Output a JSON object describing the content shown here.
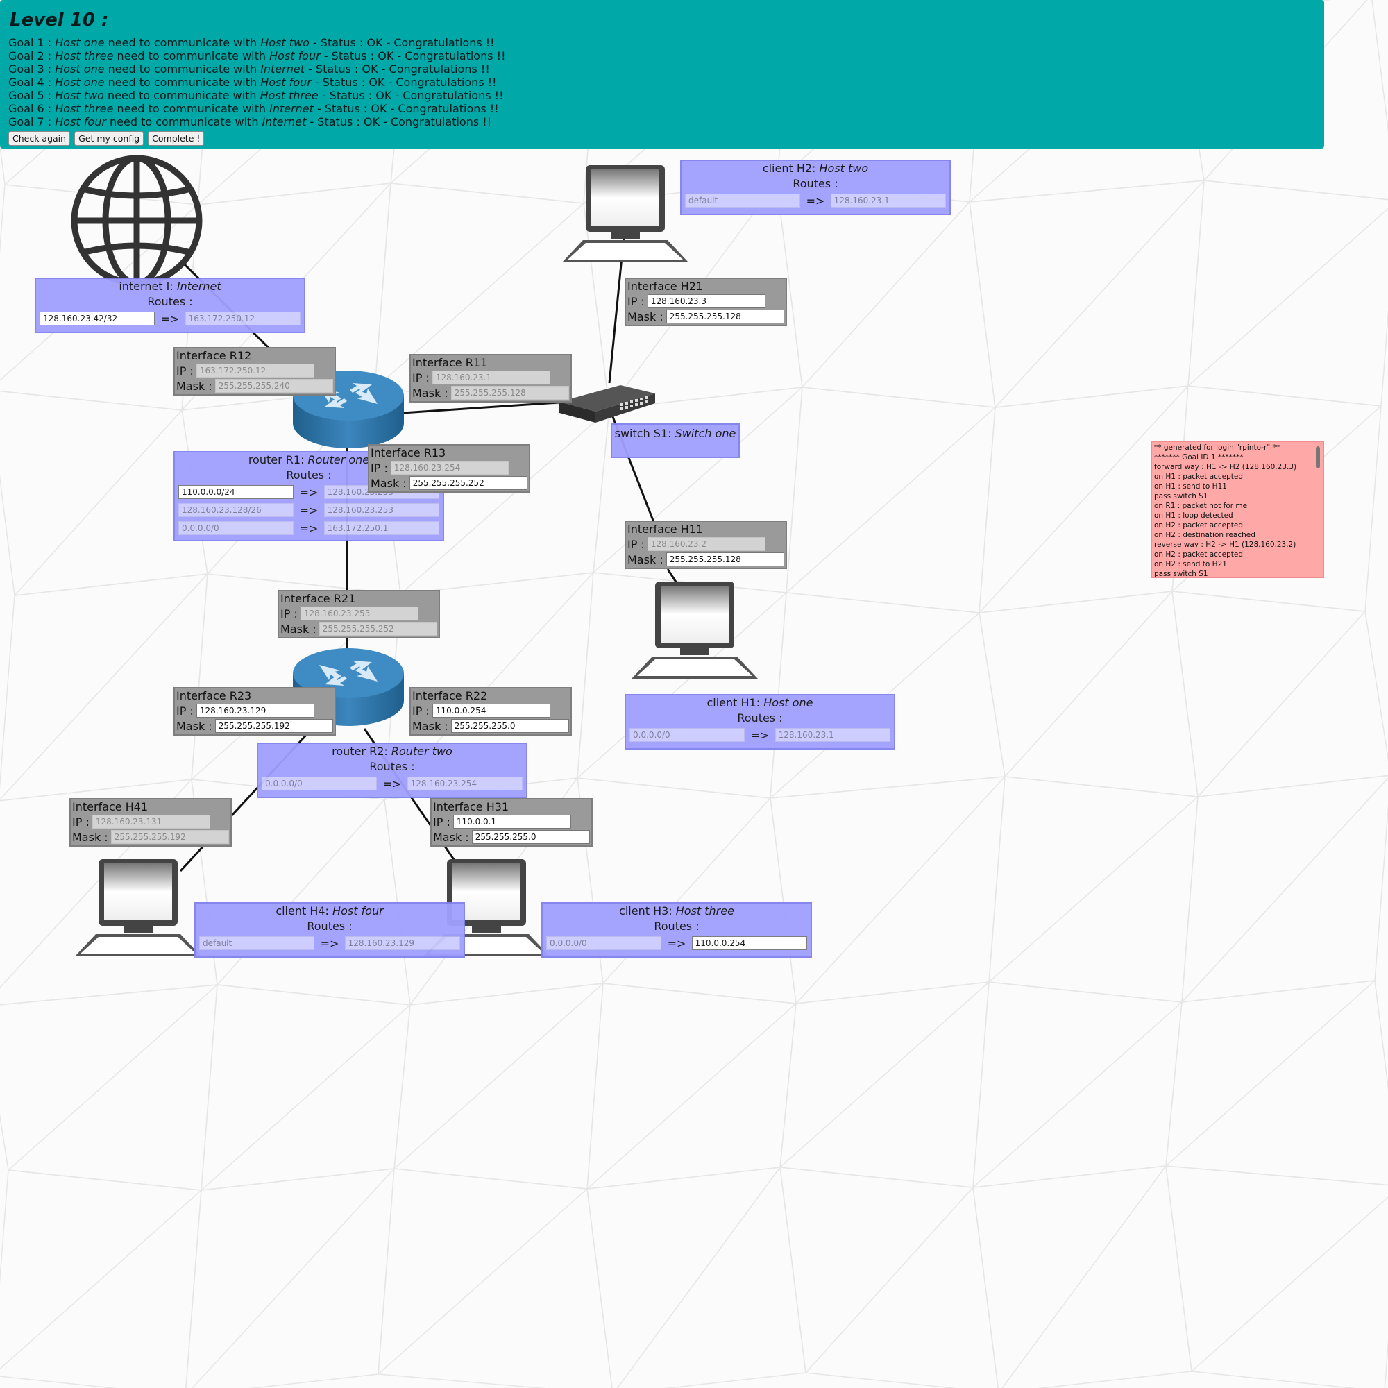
{
  "header": {
    "title": "Level 10 :",
    "goals": [
      {
        "prefix": "Goal 1 : ",
        "src": "Host one",
        "mid": " need to communicate with ",
        "dst": "Host two",
        "status": " - Status : OK - Congratulations !!"
      },
      {
        "prefix": "Goal 2 : ",
        "src": "Host three",
        "mid": " need to communicate with ",
        "dst": "Host four",
        "status": " - Status : OK - Congratulations !!"
      },
      {
        "prefix": "Goal 3 : ",
        "src": "Host one",
        "mid": " need to communicate with ",
        "dst": "Internet",
        "status": " - Status : OK - Congratulations !!"
      },
      {
        "prefix": "Goal 4 : ",
        "src": "Host one",
        "mid": " need to communicate with ",
        "dst": "Host four",
        "status": " - Status : OK - Congratulations !!"
      },
      {
        "prefix": "Goal 5 : ",
        "src": "Host two",
        "mid": " need to communicate with ",
        "dst": "Host three",
        "status": " - Status : OK - Congratulations !!"
      },
      {
        "prefix": "Goal 6 : ",
        "src": "Host three",
        "mid": " need to communicate with ",
        "dst": "Internet",
        "status": " - Status : OK - Congratulations !!"
      },
      {
        "prefix": "Goal 7 : ",
        "src": "Host four",
        "mid": " need to communicate with ",
        "dst": "Internet",
        "status": " - Status : OK - Congratulations !!"
      }
    ],
    "buttons": {
      "check": "Check again",
      "config": "Get my config",
      "complete": "Complete !"
    }
  },
  "colors": {
    "header_bg": "#00a8a8",
    "node_panel": "#a0a0ff",
    "iface_panel": "#9a9a9a",
    "console_bg": "#ffa8a8"
  },
  "nodes": {
    "internet": {
      "type_label": "internet I: ",
      "name": "Internet",
      "routes_label": "Routes :",
      "routes": [
        {
          "dest": "128.160.23.42/32",
          "gw": "163.172.250.12"
        }
      ]
    },
    "r1": {
      "type_label": "router R1: ",
      "name": "Router one",
      "routes_label": "Routes :",
      "routes": [
        {
          "dest": "110.0.0.0/24",
          "gw": "128.160.23.253"
        },
        {
          "dest": "128.160.23.128/26",
          "gw": "128.160.23.253"
        },
        {
          "dest": "0.0.0.0/0",
          "gw": "163.172.250.1"
        }
      ]
    },
    "r2": {
      "type_label": "router R2: ",
      "name": "Router two",
      "routes_label": "Routes :",
      "routes": [
        {
          "dest": "0.0.0.0/0",
          "gw": "128.160.23.254"
        }
      ]
    },
    "s1": {
      "type_label": "switch S1: ",
      "name": "Switch one"
    },
    "h1": {
      "type_label": "client H1: ",
      "name": "Host one",
      "routes_label": "Routes :",
      "routes": [
        {
          "dest": "0.0.0.0/0",
          "gw": "128.160.23.1"
        }
      ]
    },
    "h2": {
      "type_label": "client H2: ",
      "name": "Host two",
      "routes_label": "Routes :",
      "routes": [
        {
          "dest": "default",
          "gw": "128.160.23.1"
        }
      ]
    },
    "h3": {
      "type_label": "client H3: ",
      "name": "Host three",
      "routes_label": "Routes :",
      "routes": [
        {
          "dest": "0.0.0.0/0",
          "gw": "110.0.0.254"
        }
      ]
    },
    "h4": {
      "type_label": "client H4: ",
      "name": "Host four",
      "routes_label": "Routes :",
      "routes": [
        {
          "dest": "default",
          "gw": "128.160.23.129"
        }
      ]
    }
  },
  "interfaces": {
    "r12": {
      "title": "Interface R12",
      "ip": "163.172.250.12",
      "mask": "255.255.255.240"
    },
    "r11": {
      "title": "Interface R11",
      "ip": "128.160.23.1",
      "mask": "255.255.255.128"
    },
    "r13": {
      "title": "Interface R13",
      "ip": "128.160.23.254",
      "mask": "255.255.255.252"
    },
    "r21": {
      "title": "Interface R21",
      "ip": "128.160.23.253",
      "mask": "255.255.255.252"
    },
    "r22": {
      "title": "Interface R22",
      "ip": "110.0.0.254",
      "mask": "255.255.255.0"
    },
    "r23": {
      "title": "Interface R23",
      "ip": "128.160.23.129",
      "mask": "255.255.255.192"
    },
    "h11": {
      "title": "Interface H11",
      "ip": "128.160.23.2",
      "mask": "255.255.255.128"
    },
    "h21": {
      "title": "Interface H21",
      "ip": "128.160.23.3",
      "mask": "255.255.255.128"
    },
    "h31": {
      "title": "Interface H31",
      "ip": "110.0.0.1",
      "mask": "255.255.255.0"
    },
    "h41": {
      "title": "Interface H41",
      "ip": "128.160.23.131",
      "mask": "255.255.255.192"
    }
  },
  "labels": {
    "ip": "IP :",
    "mask": "Mask :",
    "arrow": "=>"
  },
  "console": {
    "lines": [
      "** generated for login \"rpinto-r\" **",
      "******* Goal ID 1 *******",
      "forward way : H1 -> H2 (128.160.23.3)",
      "on H1 : packet accepted",
      "on H1 : send to H11",
      "pass switch S1",
      "on R1 : packet not for me",
      "on H1 : loop detected",
      "on H2 : packet accepted",
      "on H2 : destination reached",
      "reverse way : H2 -> H1 (128.160.23.2)",
      "on H2 : packet accepted",
      "on H2 : send to H21",
      "pass switch S1"
    ]
  },
  "icons": {
    "internet": "globe-icon",
    "router": "router-icon",
    "switch": "switch-icon",
    "host": "computer-icon"
  }
}
